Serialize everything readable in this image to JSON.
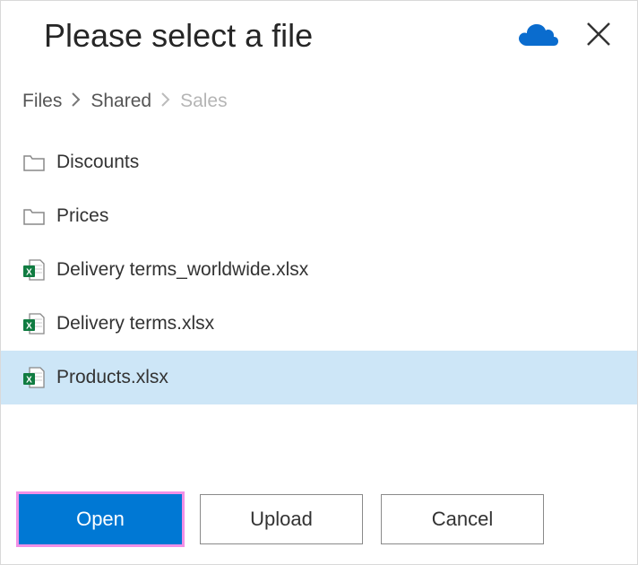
{
  "title": "Please select a file",
  "breadcrumbs": [
    {
      "label": "Files",
      "current": false
    },
    {
      "label": "Shared",
      "current": false
    },
    {
      "label": "Sales",
      "current": true
    }
  ],
  "items": [
    {
      "name": "Discounts",
      "type": "folder",
      "selected": false
    },
    {
      "name": "Prices",
      "type": "folder",
      "selected": false
    },
    {
      "name": "Delivery terms_worldwide.xlsx",
      "type": "xlsx",
      "selected": false
    },
    {
      "name": "Delivery terms.xlsx",
      "type": "xlsx",
      "selected": false
    },
    {
      "name": "Products.xlsx",
      "type": "xlsx",
      "selected": true
    }
  ],
  "buttons": {
    "open": "Open",
    "upload": "Upload",
    "cancel": "Cancel"
  }
}
